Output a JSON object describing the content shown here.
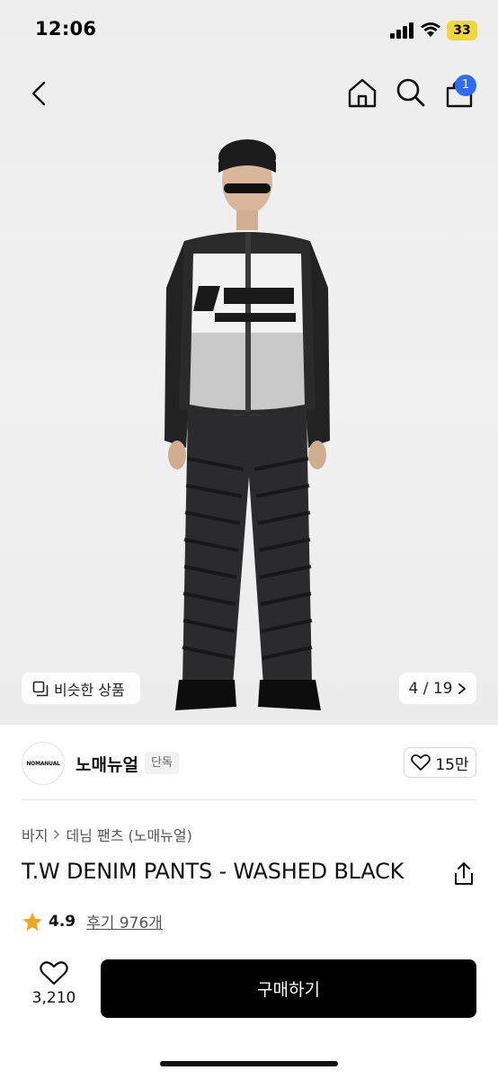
{
  "status_bar": {
    "time": "12:06",
    "battery": "33"
  },
  "nav": {
    "cart_count": "1"
  },
  "image": {
    "similar_label": "비슷한 상품",
    "pager_label": "4 / 19"
  },
  "brand": {
    "logo_text": "NOMANUAL",
    "name": "노매뉴얼",
    "tag": "단독",
    "like_count": "15만"
  },
  "breadcrumb": {
    "category": "바지",
    "subcategory": "데님 팬츠 (노매뉴얼)"
  },
  "product": {
    "title": "T.W DENIM PANTS - WASHED BLACK",
    "rating": "4.9",
    "reviews": "후기 976개"
  },
  "bottom_bar": {
    "wish_count": "3,210",
    "buy_label": "구매하기"
  },
  "colors": {
    "accent": "#2f6cf5",
    "star": "#f5a623",
    "buy_button": "#000000"
  }
}
